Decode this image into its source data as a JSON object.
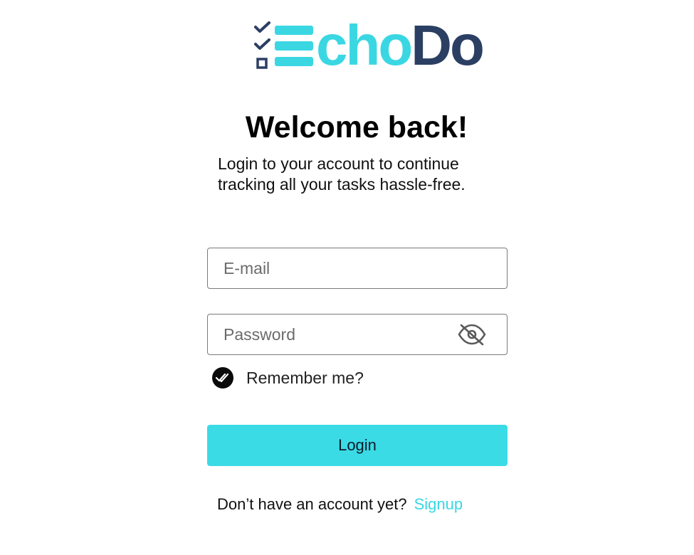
{
  "brand": {
    "name_part1": "cho",
    "name_part2": "Do",
    "colors": {
      "accent": "#3ad7e3",
      "navy": "#2b3f63"
    }
  },
  "header": {
    "title": "Welcome back!",
    "subtitle": "Login to your account to continue tracking all your tasks hassle-free."
  },
  "form": {
    "email": {
      "placeholder": "E-mail",
      "value": ""
    },
    "password": {
      "placeholder": "Password",
      "value": "",
      "toggle_icon": "eye-off-icon"
    },
    "remember": {
      "label": "Remember me?",
      "checked": true,
      "icon": "double-check-icon"
    },
    "submit_label": "Login"
  },
  "footer": {
    "prompt": "Don’t have an account yet?",
    "signup_label": "Signup"
  },
  "colors": {
    "button_bg": "#3adbe5",
    "link": "#3ad7e3"
  }
}
